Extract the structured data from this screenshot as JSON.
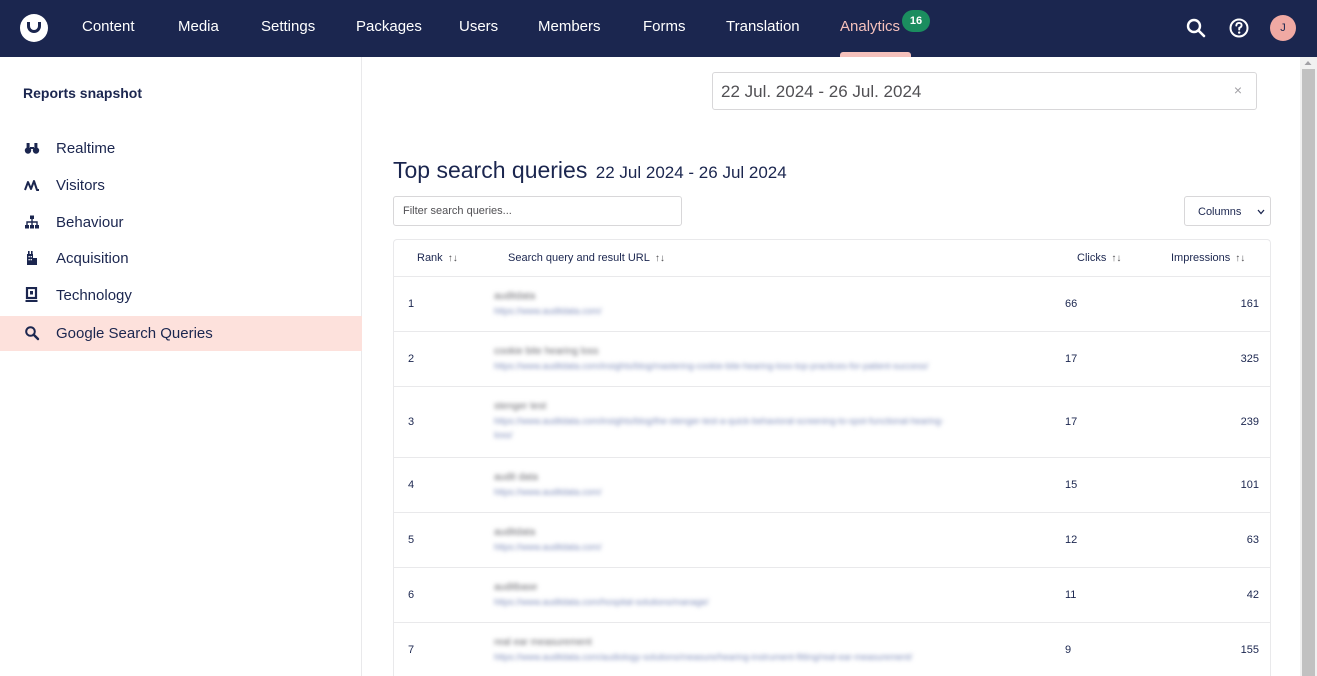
{
  "nav": {
    "items": [
      "Content",
      "Media",
      "Settings",
      "Packages",
      "Users",
      "Members",
      "Forms",
      "Translation",
      "Analytics"
    ],
    "active": "Analytics",
    "badge": "16",
    "avatar_initial": "J"
  },
  "sidebar": {
    "title": "Reports snapshot",
    "items": [
      {
        "label": "Realtime",
        "icon": "binoculars-icon"
      },
      {
        "label": "Visitors",
        "icon": "activity-icon"
      },
      {
        "label": "Behaviour",
        "icon": "sitemap-icon"
      },
      {
        "label": "Acquisition",
        "icon": "building-icon"
      },
      {
        "label": "Technology",
        "icon": "device-icon"
      },
      {
        "label": "Google Search Queries",
        "icon": "search-icon"
      }
    ],
    "active_index": 5
  },
  "date_range": {
    "value": "22 Jul. 2024 - 26 Jul. 2024",
    "clear": "×"
  },
  "report": {
    "title": "Top search queries",
    "subtitle": "22 Jul 2024 - 26 Jul 2024",
    "filter_placeholder": "Filter search queries...",
    "columns_label": "Columns",
    "sort_glyph": "↑↓"
  },
  "table": {
    "headers": {
      "rank": "Rank",
      "query": "Search query and result URL",
      "clicks": "Clicks",
      "impressions": "Impressions"
    },
    "rows": [
      {
        "rank": "1",
        "query": "auditdata",
        "url": "https://www.auditdata.com/",
        "url2": "",
        "clicks": "66",
        "impressions": "161"
      },
      {
        "rank": "2",
        "query": "cookie bite hearing loss",
        "url": "https://www.auditdata.com/insights/blog/mastering-cookie-bite-hearing-loss-top-practices-for-patient-success/",
        "url2": "",
        "clicks": "17",
        "impressions": "325"
      },
      {
        "rank": "3",
        "query": "stenger test",
        "url": "https://www.auditdata.com/insights/blog/the-stenger-test-a-quick-behavioral-screening-to-spot-functional-hearing-",
        "url2": "loss/",
        "clicks": "17",
        "impressions": "239"
      },
      {
        "rank": "4",
        "query": "audit data",
        "url": "https://www.auditdata.com/",
        "url2": "",
        "clicks": "15",
        "impressions": "101"
      },
      {
        "rank": "5",
        "query": "auditdata",
        "url": "https://www.auditdata.com/",
        "url2": "",
        "clicks": "12",
        "impressions": "63"
      },
      {
        "rank": "6",
        "query": "auditbase",
        "url": "https://www.auditdata.com/hospital-solutions/manage/",
        "url2": "",
        "clicks": "11",
        "impressions": "42"
      },
      {
        "rank": "7",
        "query": "real ear measurement",
        "url": "https://www.auditdata.com/audiology-solutions/measure/hearing-instrument-fitting/real-ear-measurement/",
        "url2": "",
        "clicks": "9",
        "impressions": "155"
      }
    ]
  },
  "colors": {
    "navy": "#1b264f",
    "active_pink": "#f5c1bc",
    "sidebar_active_bg": "#fde1dc",
    "badge_green": "#1b8d5f"
  }
}
